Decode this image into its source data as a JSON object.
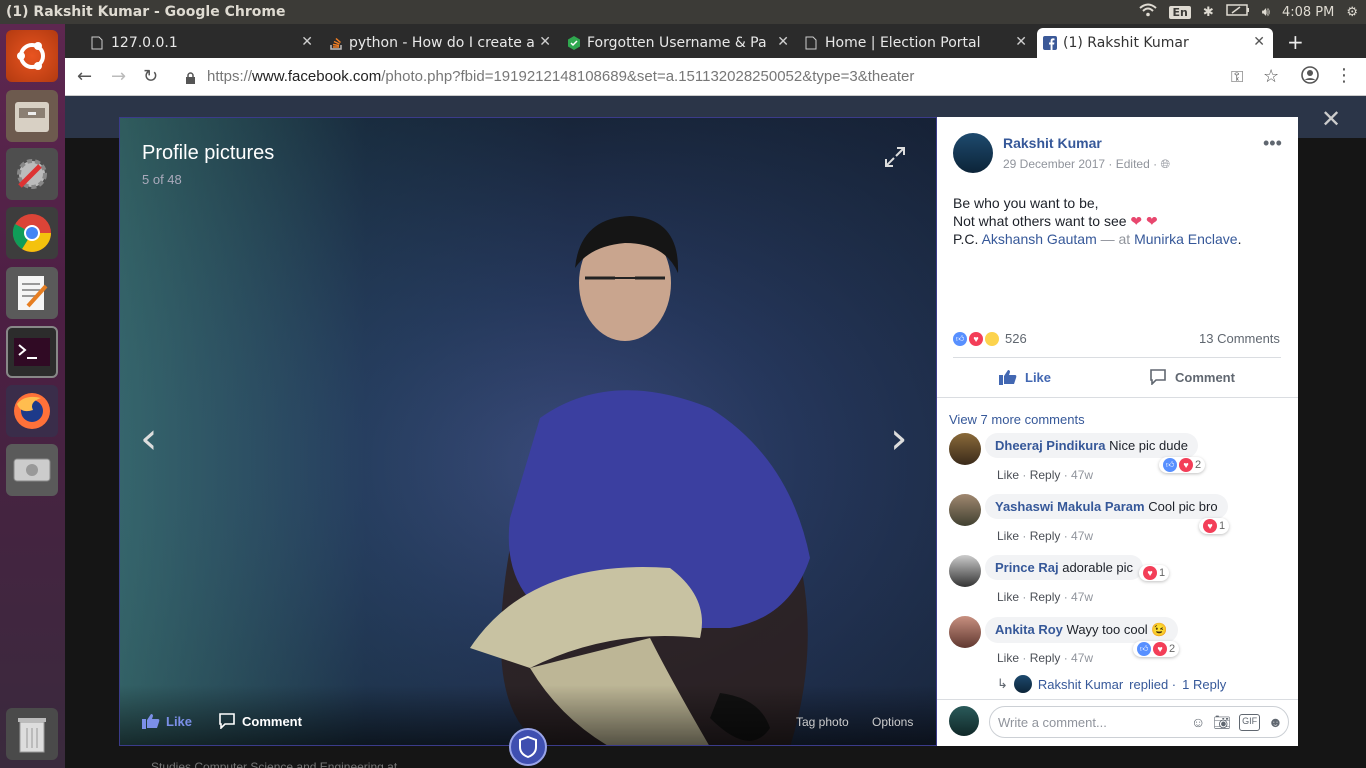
{
  "window": {
    "title": "(1) Rakshit Kumar - Google Chrome",
    "time": "4:08 PM",
    "kb_layout": "En"
  },
  "tabs": [
    {
      "label": "127.0.0.1",
      "icon": "page-icon"
    },
    {
      "label": "python - How do I create a",
      "icon": "stackoverflow-icon"
    },
    {
      "label": "Forgotten Username & Pa",
      "icon": "hex-icon"
    },
    {
      "label": "Home | Election Portal",
      "icon": "page-icon"
    },
    {
      "label": "(1) Rakshit Kumar",
      "icon": "facebook-icon",
      "active": true
    }
  ],
  "url": {
    "scheme": "https://",
    "host": "www.facebook.com",
    "path": "/photo.php?fbid=1919212148108689&set=a.151132028250052&type=3&theater"
  },
  "photo": {
    "album": "Profile pictures",
    "count": "5 of 48",
    "like": "Like",
    "comment": "Comment",
    "tag": "Tag photo",
    "options": "Options"
  },
  "post": {
    "author": "Rakshit Kumar",
    "date": "29 December 2017",
    "edited": "Edited",
    "line1": "Be who you want to be,",
    "line2": "Not what others want to see",
    "pc_prefix": "P.C.",
    "pc_name": "Akshansh Gautam",
    "at": "— at",
    "place": "Munirka Enclave",
    "reactions": "526",
    "comments_count": "13 Comments",
    "like": "Like",
    "comment": "Comment",
    "view_more": "View 7 more comments"
  },
  "comments": [
    {
      "name": "Dheeraj Pindikura",
      "text": "Nice pic dude",
      "react": "2",
      "time": "47w"
    },
    {
      "name": "Yashaswi Makula Param",
      "text": "Cool pic bro",
      "react": "1",
      "time": "47w"
    },
    {
      "name": "Prince Raj",
      "text": "adorable pic",
      "react": "1",
      "time": "47w"
    },
    {
      "name": "Ankita Roy",
      "text": "Wayy too cool 😉",
      "react": "2",
      "time": "47w"
    }
  ],
  "comment_actions": {
    "like": "Like",
    "reply": "Reply"
  },
  "replied": {
    "name": "Rakshit Kumar",
    "text": "replied ·",
    "link": "1 Reply"
  },
  "write_comment": "Write a comment...",
  "bg_text": "Studies Computer Science and Engineering at"
}
